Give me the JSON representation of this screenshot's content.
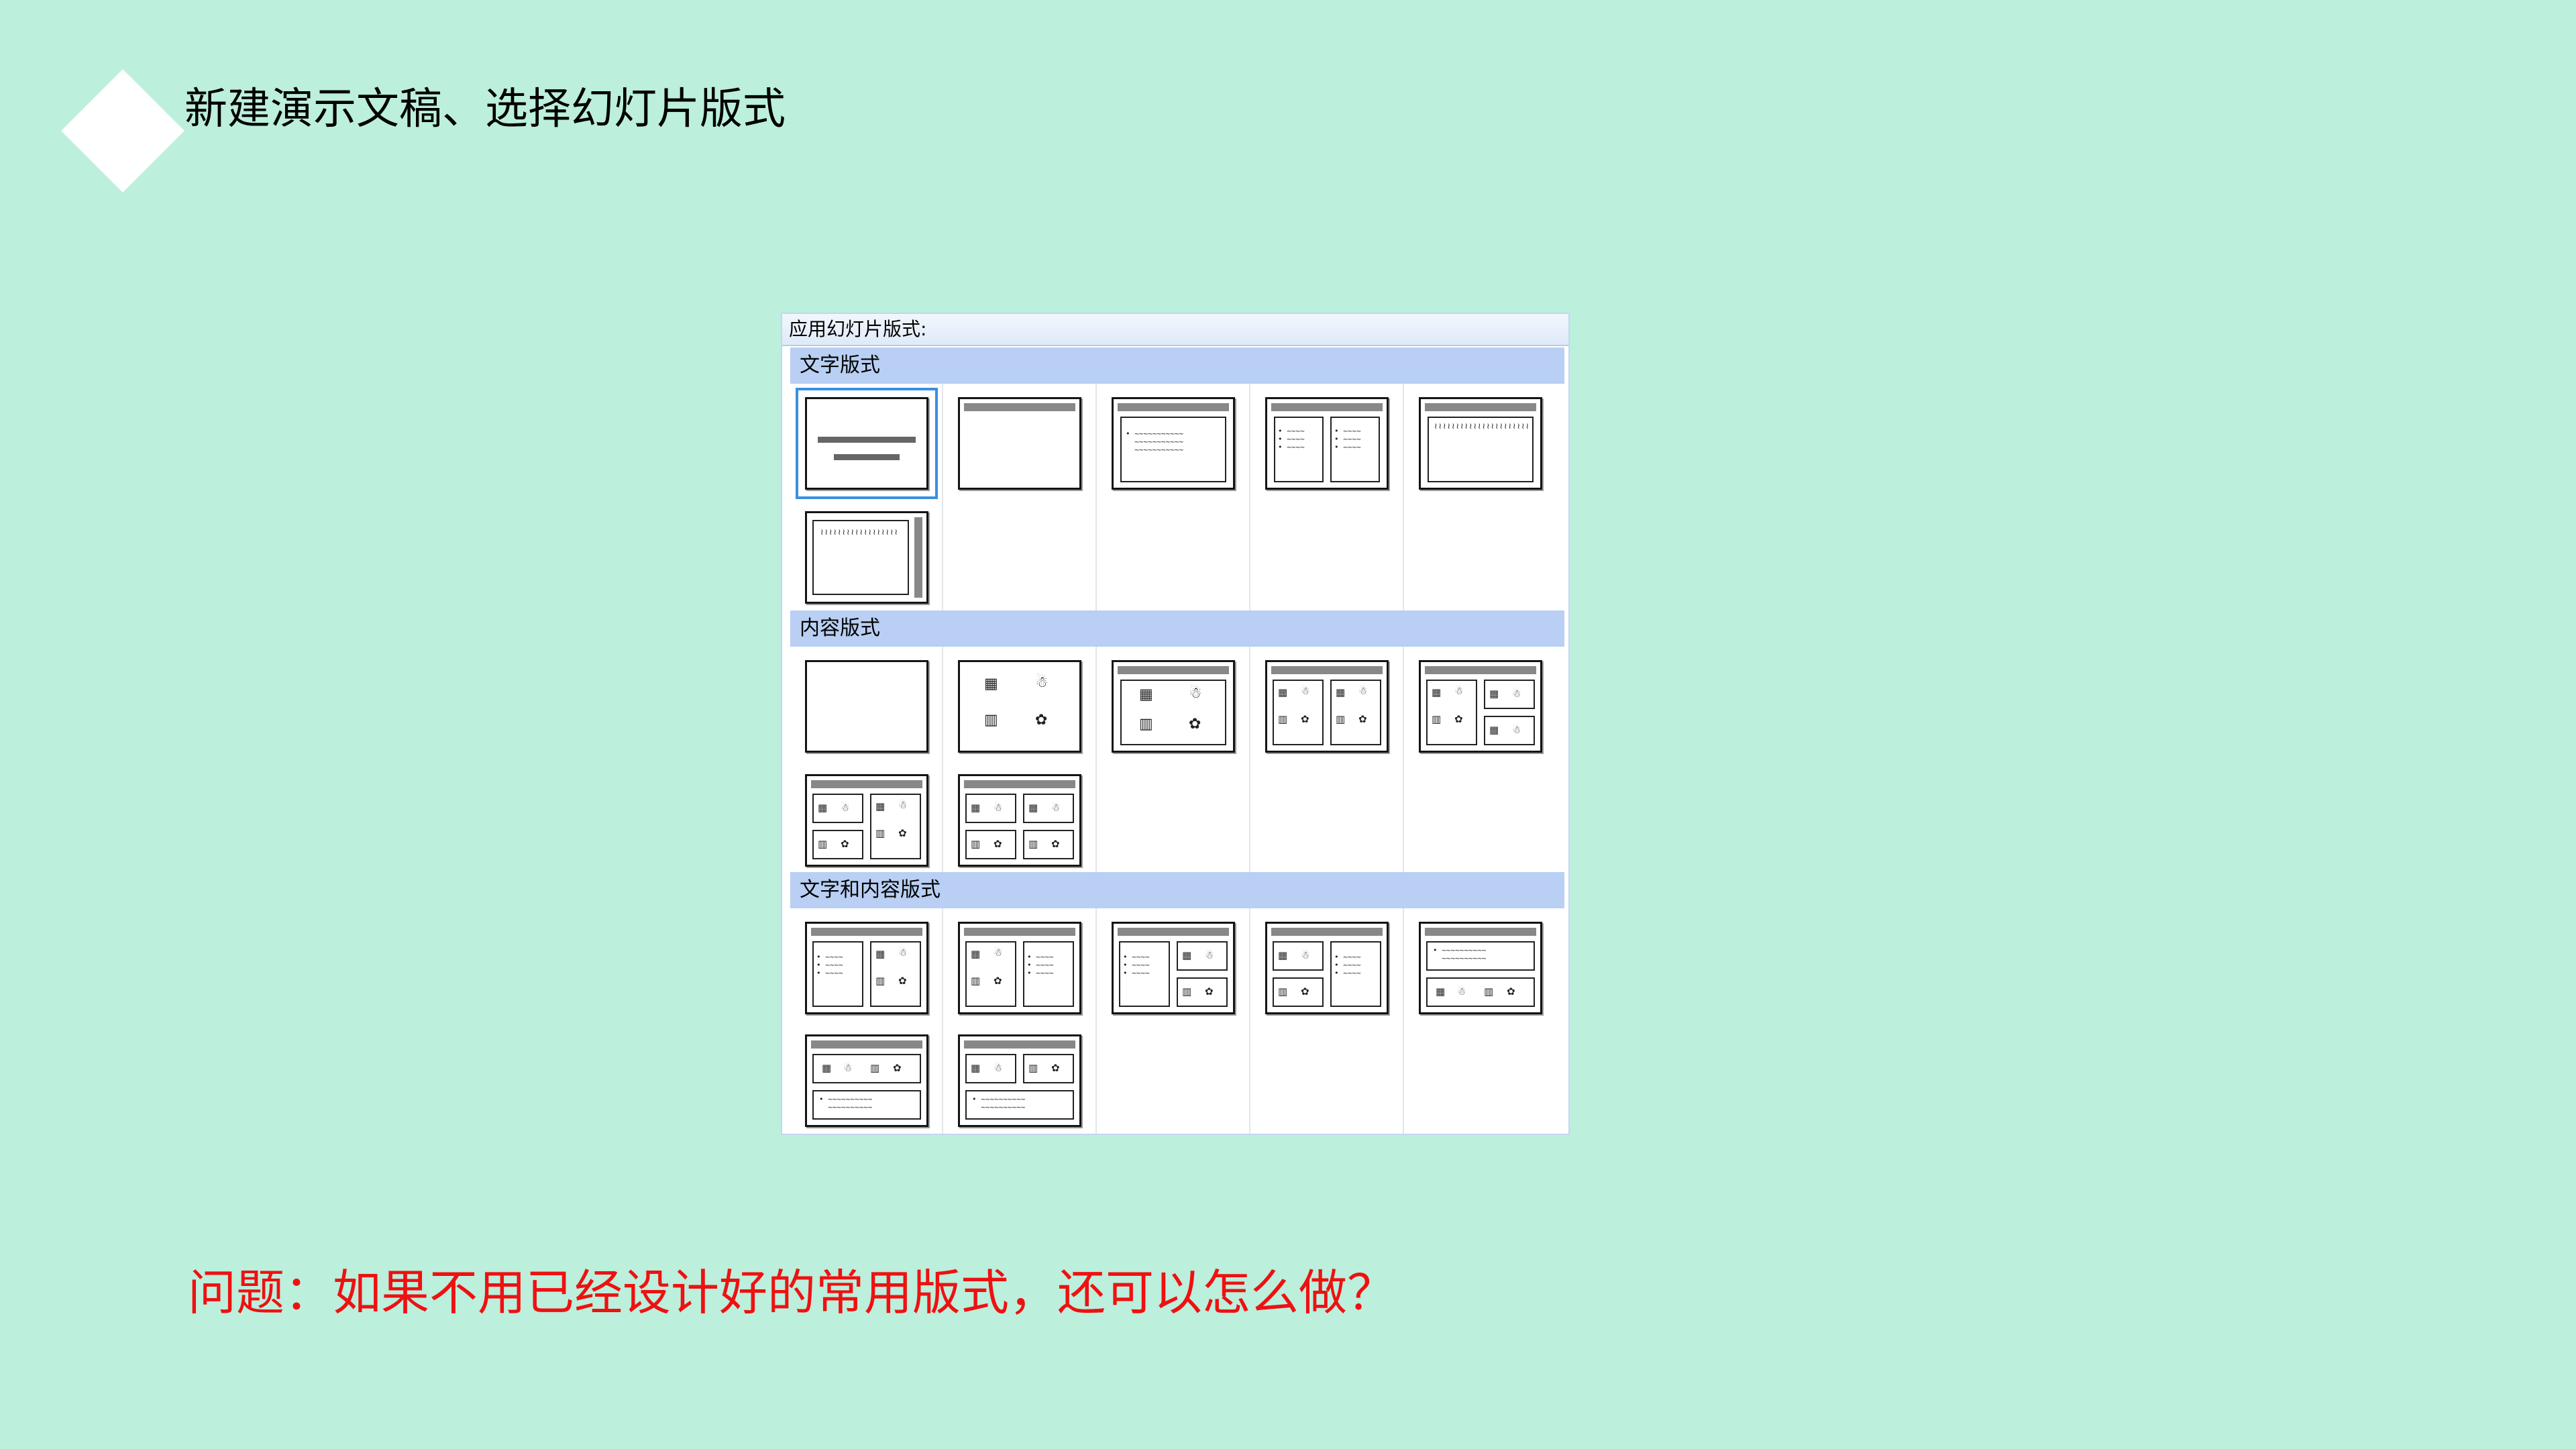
{
  "slide": {
    "title": "新建演示文稿、选择幻灯片版式",
    "question": "问题：如果不用已经设计好的常用版式，还可以怎么做？"
  },
  "pane": {
    "header": "应用幻灯片版式:",
    "sections": [
      {
        "label": "文字版式"
      },
      {
        "label": "内容版式"
      },
      {
        "label": "文字和内容版式"
      }
    ]
  },
  "icons": {
    "table": "▦",
    "person": "☃",
    "chart": "▥",
    "cycle": "✿",
    "bullets": "•"
  },
  "colors": {
    "background": "#bcefdc",
    "question_text": "#ee1111",
    "section_bar": "#b9cff3",
    "selection": "#3b8fe0"
  }
}
